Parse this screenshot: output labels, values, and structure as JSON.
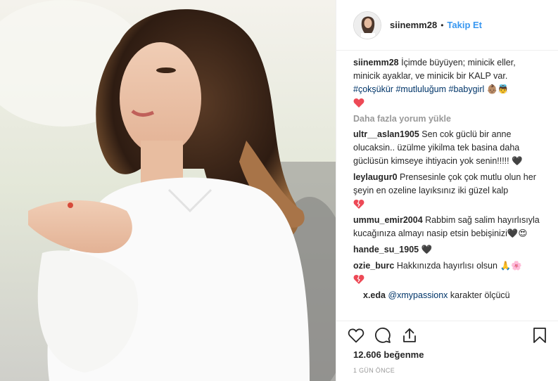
{
  "post": {
    "author": "siinemm28",
    "separator": "•",
    "follow_label": "Takip Et",
    "caption_text": "İçimde büyüyen; minicik eller, minicik ayaklar, ve minicik bir KALP var.",
    "hashtags": [
      "#çokşükür",
      "#mutluluğum",
      "#babygirl"
    ],
    "caption_emoji": "👶🏽👼",
    "load_more_label": "Daha fazla yorum yükle",
    "likes_label": "12.606 beğenme",
    "time_label": "1 GÜN ÖNCE"
  },
  "comments": [
    {
      "user": "ultr__aslan1905",
      "text": "Sen cok güclü bir anne olucaksin.. üzülme yikilma tek basina daha güclüsün kimseye ihtiyacin yok senin!!!!! 🖤"
    },
    {
      "user": "leylaugur0",
      "text": "Prensesinle çok çok mutlu olun her şeyin en ozeline layıksınız iki güzel kalp"
    },
    {
      "user": "ummu_emir2004",
      "text": "Rabbim sağ salim hayırlısıyla kucağınıza almayı nasip etsin bebişinizi🖤😍"
    },
    {
      "user": "hande_su_1905",
      "text": "🖤"
    },
    {
      "user": "ozie_burc",
      "text": "Hakkınızda hayırlısı olsun 🙏🌸"
    }
  ],
  "reply": {
    "user": "x.eda",
    "mention": "@xmypassionx",
    "text": "karakter ölçücü"
  },
  "colors": {
    "link": "#3897f0",
    "hashtag": "#003569",
    "heart": "#ed4956",
    "muted": "#999999"
  },
  "icons": [
    "heart-icon",
    "comment-icon",
    "share-icon",
    "bookmark-icon"
  ]
}
